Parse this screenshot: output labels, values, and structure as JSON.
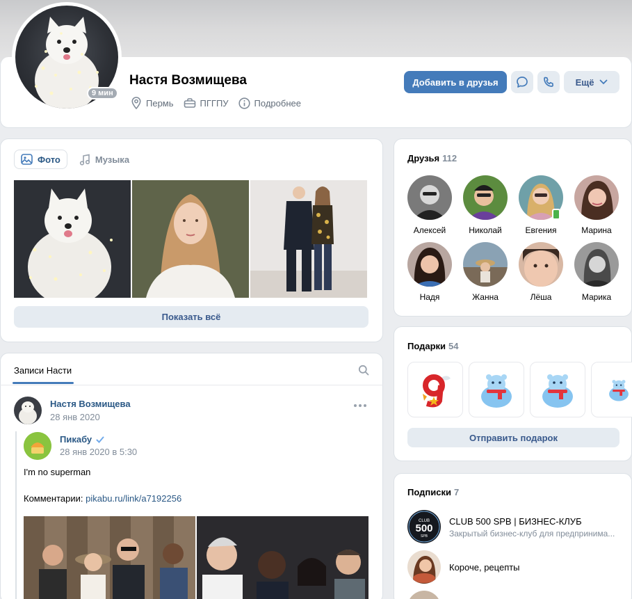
{
  "profile": {
    "name": "Настя Возмищева",
    "online_badge": "9 мин",
    "city": "Пермь",
    "university": "ПГГПУ",
    "more_info": "Подробнее",
    "add_friend": "Добавить в друзья",
    "more_button": "Ещё"
  },
  "media_tabs": [
    {
      "label": "Фото",
      "icon": "image-icon",
      "active": true
    },
    {
      "label": "Музыка",
      "icon": "music-note-icon",
      "active": false
    }
  ],
  "show_all": "Показать всё",
  "wall": {
    "title": "Записи Насти",
    "post": {
      "author": "Настя Возмищева",
      "date": "28 янв 2020",
      "repost_source": "Пикабу",
      "repost_date": "28 янв 2020 в 5:30",
      "text": "I'm no superman",
      "comments_prefix": "Комментарии:",
      "comments_link": "pikabu.ru/link/a7192256"
    }
  },
  "friends": {
    "title": "Друзья",
    "count": "112",
    "items": [
      {
        "name": "Алексей"
      },
      {
        "name": "Николай"
      },
      {
        "name": "Евгения"
      },
      {
        "name": "Марина"
      },
      {
        "name": "Надя"
      },
      {
        "name": "Жанна"
      },
      {
        "name": "Лёша"
      },
      {
        "name": "Марика"
      }
    ]
  },
  "gifts": {
    "title": "Подарки",
    "count": "54",
    "send": "Отправить подарок"
  },
  "subscriptions": {
    "title": "Подписки",
    "count": "7",
    "items": [
      {
        "name": "CLUB 500 SPB | БИЗНЕС-КЛУБ",
        "desc": "Закрытый бизнес-клуб для предпринима..."
      },
      {
        "name": "Короче, рецепты",
        "desc": ""
      }
    ],
    "club_logo_text": "CLUB 500 SPB"
  },
  "colors": {
    "accent": "#447bba",
    "link": "#2a5885",
    "secondary_button": "#e5ebf1",
    "background": "#ebedf0"
  }
}
